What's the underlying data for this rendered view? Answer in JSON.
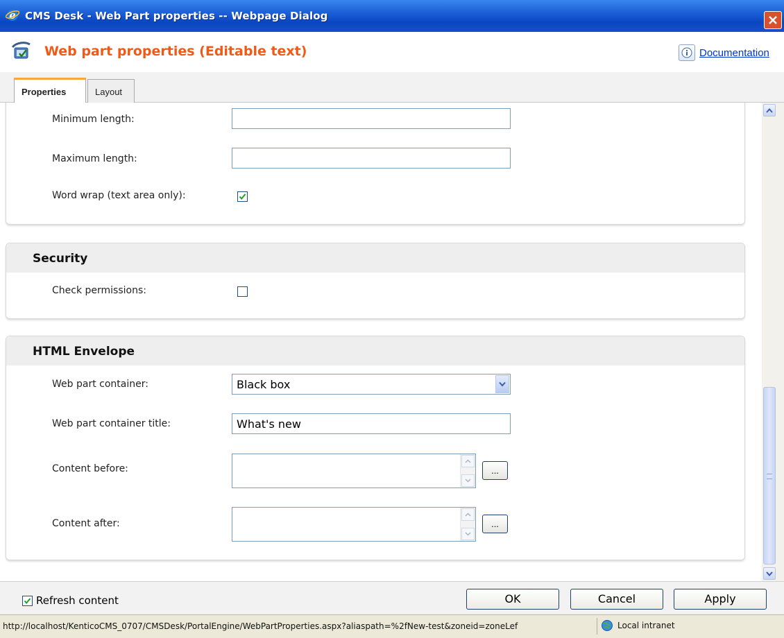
{
  "window": {
    "title": "CMS Desk - Web Part properties -- Webpage Dialog"
  },
  "header": {
    "title": "Web part properties (Editable text)",
    "doc_link": "Documentation"
  },
  "tabs": [
    {
      "label": "Properties",
      "active": true
    },
    {
      "label": "Layout",
      "active": false
    }
  ],
  "form": {
    "min_length": {
      "label": "Minimum length:",
      "value": ""
    },
    "max_length": {
      "label": "Maximum length:",
      "value": ""
    },
    "word_wrap": {
      "label": "Word wrap (text area only):",
      "checked": true
    }
  },
  "security": {
    "title": "Security",
    "check_permissions": {
      "label": "Check permissions:",
      "checked": false
    }
  },
  "envelope": {
    "title": "HTML Envelope",
    "container": {
      "label": "Web part container:",
      "value": "Black box"
    },
    "container_title": {
      "label": "Web part container title:",
      "value": "What's new"
    },
    "content_before": {
      "label": "Content before:",
      "value": "",
      "button": "..."
    },
    "content_after": {
      "label": "Content after:",
      "value": "",
      "button": "..."
    }
  },
  "footer": {
    "refresh_label": "Refresh content",
    "refresh_checked": true,
    "ok": "OK",
    "cancel": "Cancel",
    "apply": "Apply"
  },
  "statusbar": {
    "url": "http://localhost/KenticoCMS_0707/CMSDesk/PortalEngine/WebPartProperties.aspx?aliaspath=%2fNew-test&zoneid=zoneLef",
    "zone": "Local intranet"
  },
  "colors": {
    "header_title": "#f05a16",
    "tab_accent": "#f7a63a",
    "titlebar": "#0a46c2"
  }
}
